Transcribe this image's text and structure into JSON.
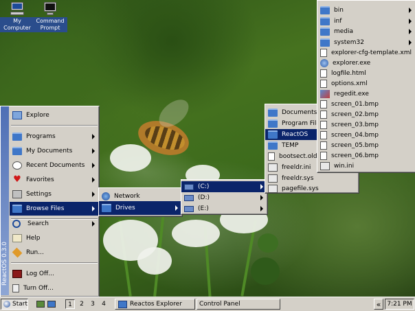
{
  "desktop": {
    "icons": [
      {
        "name": "my-computer",
        "label_line1": "My",
        "label_line2": "Computer"
      },
      {
        "name": "command-prompt",
        "label_line1": "Command",
        "label_line2": "Prompt"
      }
    ]
  },
  "start_menu": {
    "sidebar_text": "ReactOS  0.3.0",
    "items": [
      {
        "label": "Explore",
        "icon": "explore-icon",
        "submenu": false
      },
      {
        "label": "Programs",
        "icon": "programs-folder-icon",
        "submenu": true
      },
      {
        "label": "My Documents",
        "icon": "documents-folder-icon",
        "submenu": true
      },
      {
        "label": "Recent Documents",
        "icon": "recent-documents-icon",
        "submenu": true
      },
      {
        "label": "Favorites",
        "icon": "favorites-heart-icon",
        "submenu": true
      },
      {
        "label": "Settings",
        "icon": "settings-icon",
        "submenu": true
      },
      {
        "label": "Browse Files",
        "icon": "browse-files-icon",
        "submenu": true
      },
      {
        "label": "Search",
        "icon": "search-icon",
        "submenu": true
      },
      {
        "label": "Help",
        "icon": "help-icon",
        "submenu": false
      },
      {
        "label": "Run...",
        "icon": "run-icon",
        "submenu": false
      },
      {
        "label": "Log Off...",
        "icon": "log-off-icon",
        "submenu": false
      },
      {
        "label": "Turn Off...",
        "icon": "turn-off-icon",
        "submenu": false
      }
    ]
  },
  "browse_menu": {
    "items": [
      {
        "label": "Network",
        "submenu": false
      },
      {
        "label": "Drives",
        "submenu": true
      }
    ]
  },
  "drives_menu": {
    "items": [
      {
        "label": "(C:)"
      },
      {
        "label": "(D:)"
      },
      {
        "label": "(E:)"
      }
    ]
  },
  "c_menu": {
    "items": [
      {
        "label": "Documents and Settings",
        "type": "folder"
      },
      {
        "label": "Program Files",
        "type": "folder"
      },
      {
        "label": "ReactOS",
        "type": "folder"
      },
      {
        "label": "TEMP",
        "type": "folder"
      },
      {
        "label": "bootsect.old",
        "type": "file"
      },
      {
        "label": "freeldr.ini",
        "type": "file"
      },
      {
        "label": "freeldr.sys",
        "type": "file"
      },
      {
        "label": "pagefile.sys",
        "type": "file"
      }
    ]
  },
  "reactos_menu": {
    "items": [
      {
        "label": "bin",
        "type": "folder"
      },
      {
        "label": "inf",
        "type": "folder"
      },
      {
        "label": "media",
        "type": "folder"
      },
      {
        "label": "system32",
        "type": "folder"
      },
      {
        "label": "explorer-cfg-template.xml",
        "type": "file"
      },
      {
        "label": "explorer.exe",
        "type": "exe"
      },
      {
        "label": "logfile.html",
        "type": "file"
      },
      {
        "label": "options.xml",
        "type": "file"
      },
      {
        "label": "regedit.exe",
        "type": "exe"
      },
      {
        "label": "screen_01.bmp",
        "type": "file"
      },
      {
        "label": "screen_02.bmp",
        "type": "file"
      },
      {
        "label": "screen_03.bmp",
        "type": "file"
      },
      {
        "label": "screen_04.bmp",
        "type": "file"
      },
      {
        "label": "screen_05.bmp",
        "type": "file"
      },
      {
        "label": "screen_06.bmp",
        "type": "file"
      },
      {
        "label": "win.ini",
        "type": "file"
      }
    ]
  },
  "taskbar": {
    "start_label": "Start",
    "workspaces": [
      "1",
      "2",
      "3",
      "4"
    ],
    "tasks": [
      {
        "label": "Reactos Explorer"
      },
      {
        "label": "Control Panel"
      }
    ],
    "tray_toggle": "«",
    "clock": "7:21 PM"
  }
}
